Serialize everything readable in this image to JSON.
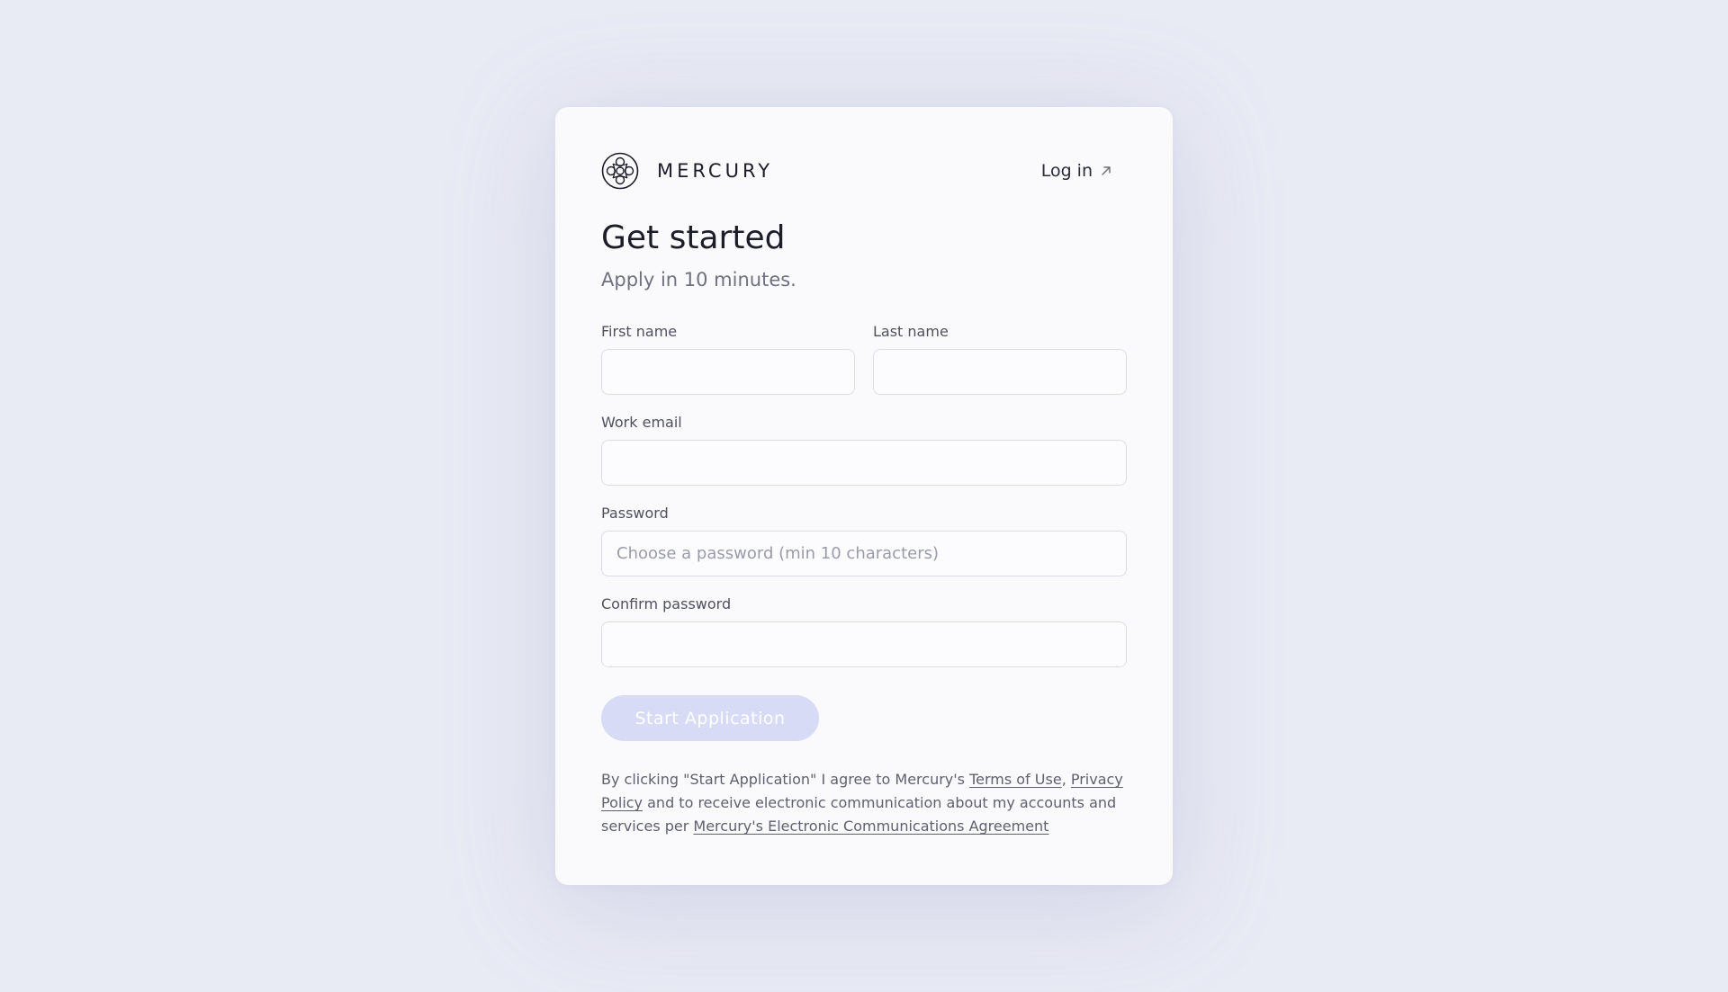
{
  "brand": {
    "name": "MERCURY"
  },
  "header": {
    "login_label": "Log in"
  },
  "main": {
    "title": "Get started",
    "subtitle": "Apply in 10 minutes."
  },
  "form": {
    "first_name": {
      "label": "First name",
      "value": "",
      "placeholder": ""
    },
    "last_name": {
      "label": "Last name",
      "value": "",
      "placeholder": ""
    },
    "work_email": {
      "label": "Work email",
      "value": "",
      "placeholder": ""
    },
    "password": {
      "label": "Password",
      "value": "",
      "placeholder": "Choose a password (min 10 characters)"
    },
    "confirm_password": {
      "label": "Confirm password",
      "value": "",
      "placeholder": ""
    },
    "submit_label": "Start Application"
  },
  "legal": {
    "prefix": "By clicking \"Start Application\" I agree to Mercury's ",
    "terms_link": "Terms of Use",
    "separator": ", ",
    "privacy_link": "Privacy Policy",
    "middle": " and to receive electronic communication about my accounts and services per ",
    "agreement_link": "Mercury's Electronic Communications Agreement"
  },
  "colors": {
    "background": "#e8eaf4",
    "card": "#fafafd",
    "button_disabled": "#d8dbf6",
    "text_primary": "#1c1d28",
    "text_muted": "#70717f"
  },
  "icons": {
    "logo": "mercury-logo-icon",
    "login": "arrow-up-right-icon"
  }
}
